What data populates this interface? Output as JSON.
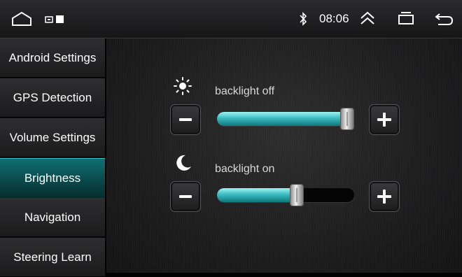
{
  "status_bar": {
    "time": "08:06",
    "icons": [
      "home-icon",
      "notification-icons",
      "bluetooth-icon",
      "collapse-up-icon",
      "recents-icon",
      "back-icon"
    ]
  },
  "sidebar": {
    "items": [
      {
        "label": "Android Settings"
      },
      {
        "label": "GPS Detection"
      },
      {
        "label": "Volume Settings"
      },
      {
        "label": "Brightness",
        "active": true
      },
      {
        "label": "Navigation"
      },
      {
        "label": "Steering Learn"
      }
    ]
  },
  "brightness": {
    "rows": [
      {
        "label": "backlight off",
        "icon": "sun-icon",
        "level": 0.95
      },
      {
        "label": "backlight on",
        "icon": "moon-icon",
        "level": 0.58
      }
    ]
  },
  "colors": {
    "accent": "#3bbcc0",
    "active_tab": "#0b4a4d"
  }
}
